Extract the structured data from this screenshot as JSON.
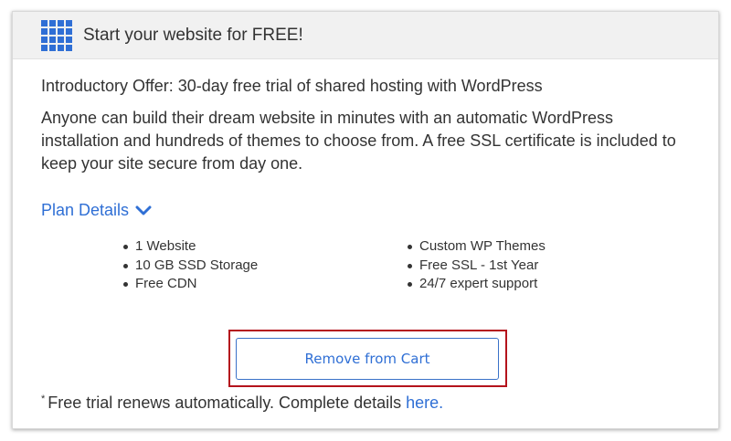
{
  "header": {
    "title": "Start your website for FREE!",
    "icon": "grid-icon"
  },
  "offer": {
    "title": "Introductory Offer: 30-day free trial of shared hosting with WordPress",
    "description": "Anyone can build their dream website in minutes with an automatic WordPress installation and hundreds of themes to choose from. A free SSL certificate is included to keep your site secure from day one."
  },
  "plan_details": {
    "label": "Plan Details",
    "icon": "chevron-down-icon"
  },
  "features": {
    "left": [
      "1 Website",
      "10 GB SSD Storage",
      "Free CDN"
    ],
    "right": [
      "Custom WP Themes",
      "Free SSL - 1st Year",
      "24/7 expert support"
    ]
  },
  "actions": {
    "remove_label": "Remove from Cart"
  },
  "footnote": {
    "marker": "*",
    "text": "Free trial renews automatically. Complete details ",
    "link": "here."
  },
  "colors": {
    "accent": "#2f6fd5",
    "highlight": "#b4131c",
    "header_bg": "#f1f1f1"
  }
}
